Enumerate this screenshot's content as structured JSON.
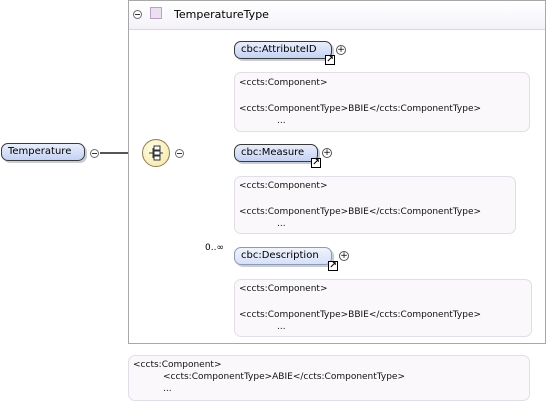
{
  "root_element": {
    "label": "Temperature"
  },
  "type_container": {
    "title": "TemperatureType"
  },
  "compositor": {
    "kind": "sequence",
    "icon": "sequence-compositor-icon"
  },
  "children": [
    {
      "label": "cbc:AttributeID",
      "annotation": [
        "<ccts:Component>",
        "<ccts:ComponentType>BBIE</ccts:ComponentType>",
        "..."
      ]
    },
    {
      "label": "cbc:Measure",
      "annotation": [
        "<ccts:Component>",
        "<ccts:ComponentType>BBIE</ccts:ComponentType>",
        "..."
      ]
    },
    {
      "label": "cbc:Description",
      "cardinality": "0..∞",
      "annotation": [
        "<ccts:Component>",
        "<ccts:ComponentType>BBIE</ccts:ComponentType>",
        "..."
      ]
    }
  ],
  "type_annotation": [
    "<ccts:Component>",
    "<ccts:ComponentType>ABIE</ccts:ComponentType>",
    "..."
  ],
  "colors": {
    "element_fill": "#c4d2f3",
    "annotation_bg": "#faf8fb",
    "compositor_fill": "#f5e6a3",
    "type_icon": "#eddff0"
  }
}
